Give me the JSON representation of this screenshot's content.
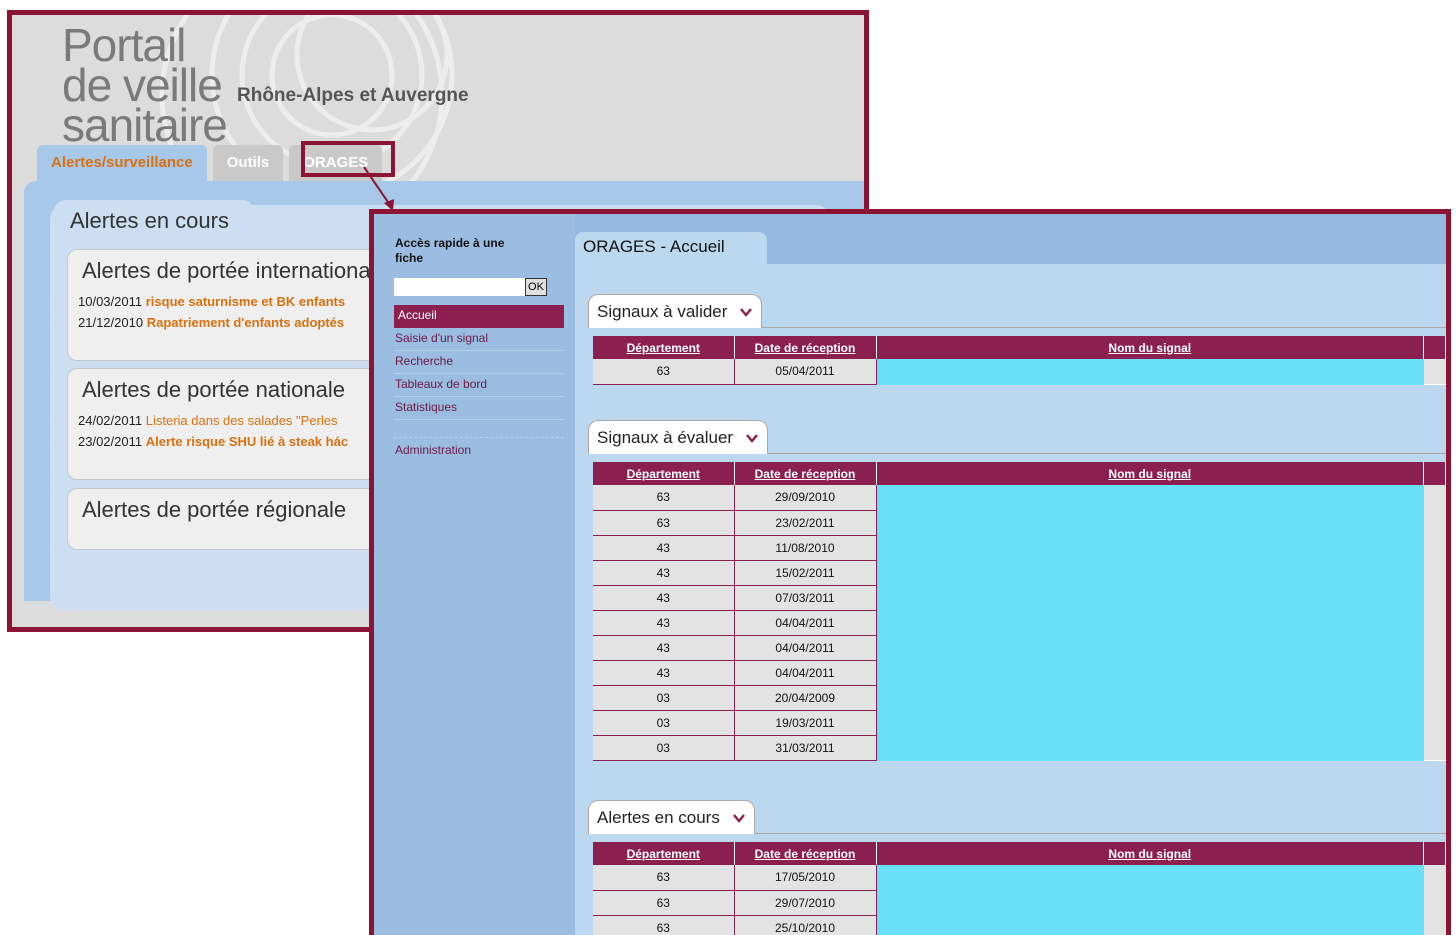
{
  "portal": {
    "logo_line1": "Portail",
    "logo_line2": "de veille",
    "logo_line3": "sanitaire",
    "region": "Rhône-Alpes et Auvergne",
    "tabs": [
      "Alertes/surveillance",
      "Outils",
      "ORAGES"
    ],
    "panel_title": "Alertes en cours",
    "sections": [
      {
        "title": "Alertes de portée internationale",
        "rows": [
          {
            "date": "10/03/2011",
            "text": "risque saturnisme et BK enfants"
          },
          {
            "date": "21/12/2010",
            "text": "Rapatriement d'enfants adoptés"
          }
        ]
      },
      {
        "title": "Alertes de portée nationale",
        "rows": [
          {
            "date": "24/02/2011",
            "text": "Listeria dans des salades \"Perles"
          },
          {
            "date": "23/02/2011",
            "text": "Alerte risque SHU lié à steak hác"
          }
        ]
      },
      {
        "title": "Alertes de portée régionale",
        "rows": []
      }
    ],
    "colors": {
      "frame": "#8c1333",
      "link": "#d9700f"
    }
  },
  "orages": {
    "quick_access": "Accès rapide à une fiche",
    "quick_input": "",
    "ok_label": "OK",
    "nav": [
      "Accueil",
      "Saisie d'un signal",
      "Recherche",
      "Tableaux de bord",
      "Statistiques",
      "Administration"
    ],
    "page_title": "ORAGES - Accueil",
    "columns": [
      "Département",
      "Date de réception",
      "Nom du signal"
    ],
    "blocks": [
      {
        "title": "Signaux à valider",
        "rows": [
          [
            "63",
            "05/04/2011"
          ]
        ]
      },
      {
        "title": "Signaux à évaluer",
        "rows": [
          [
            "63",
            "29/09/2010"
          ],
          [
            "63",
            "23/02/2011"
          ],
          [
            "43",
            "11/08/2010"
          ],
          [
            "43",
            "15/02/2011"
          ],
          [
            "43",
            "07/03/2011"
          ],
          [
            "43",
            "04/04/2011"
          ],
          [
            "43",
            "04/04/2011"
          ],
          [
            "43",
            "04/04/2011"
          ],
          [
            "03",
            "20/04/2009"
          ],
          [
            "03",
            "19/03/2011"
          ],
          [
            "03",
            "31/03/2011"
          ]
        ]
      },
      {
        "title": "Alertes en cours",
        "rows": [
          [
            "63",
            "17/05/2010"
          ],
          [
            "63",
            "29/07/2010"
          ],
          [
            "63",
            "25/10/2010"
          ]
        ]
      }
    ],
    "colors": {
      "header": "#8b1f4f",
      "redaction": "#6ae0f7",
      "sidebar": "#9bbde2"
    }
  }
}
